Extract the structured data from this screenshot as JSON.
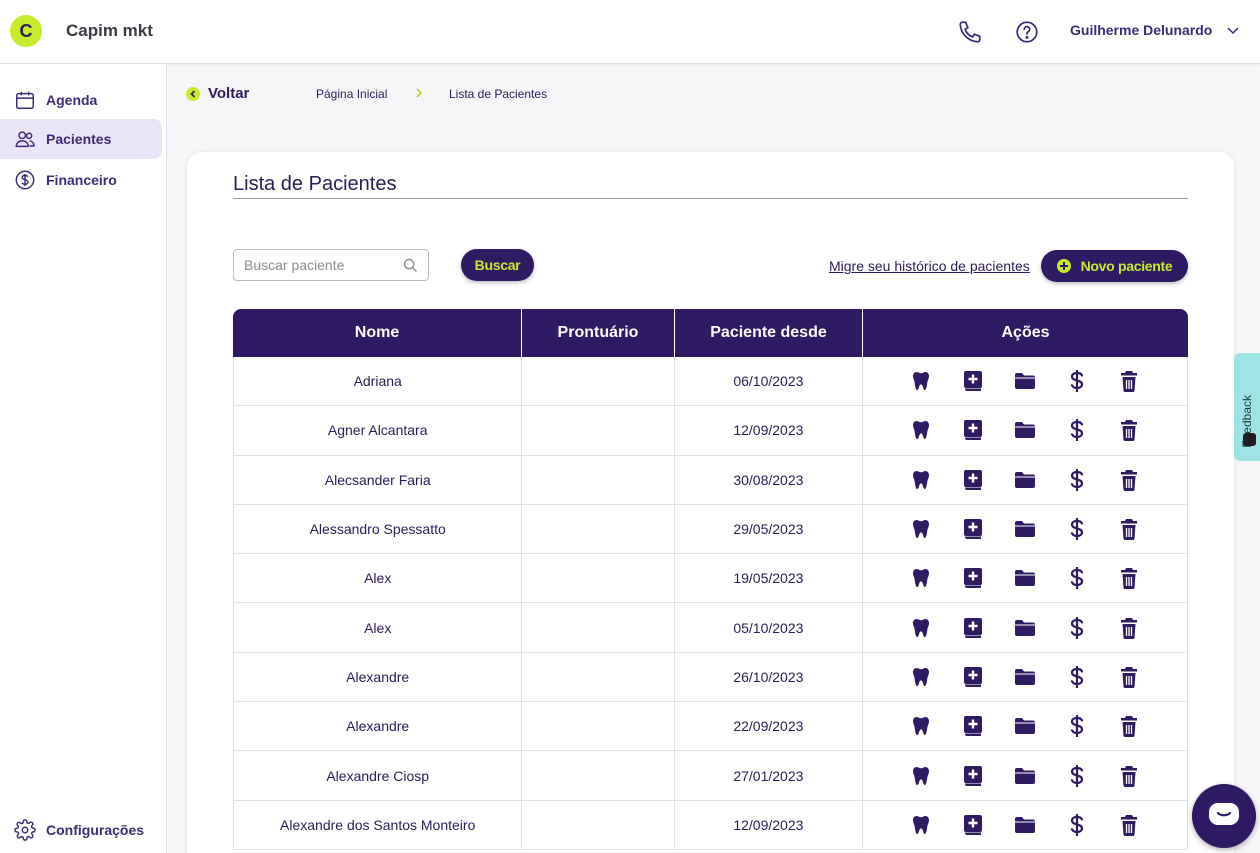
{
  "app": {
    "logo_letter": "C",
    "name": "Capim mkt"
  },
  "header": {
    "user_name": "Guilherme Delunardo"
  },
  "sidebar": {
    "items": [
      {
        "label": "Agenda",
        "icon": "calendar-icon"
      },
      {
        "label": "Pacientes",
        "icon": "users-icon",
        "active": true
      },
      {
        "label": "Financeiro",
        "icon": "dollar-circle-icon"
      }
    ],
    "settings_label": "Configurações"
  },
  "breadcrumb": {
    "back_label": "Voltar",
    "home": "Página Inicial",
    "current": "Lista de Pacientes"
  },
  "page": {
    "title": "Lista de Pacientes",
    "search_placeholder": "Buscar paciente",
    "search_value": "",
    "search_button": "Buscar",
    "migrate_link": "Migre seu histórico de pacientes",
    "new_patient_button": "Novo paciente"
  },
  "table": {
    "headers": [
      "Nome",
      "Prontuário",
      "Paciente desde",
      "Ações"
    ],
    "rows": [
      {
        "name": "Adriana",
        "record": "",
        "since": "06/10/2023"
      },
      {
        "name": "Agner Alcantara",
        "record": "",
        "since": "12/09/2023"
      },
      {
        "name": "Alecsander Faria",
        "record": "",
        "since": "30/08/2023"
      },
      {
        "name": "Alessandro Spessatto",
        "record": "",
        "since": "29/05/2023"
      },
      {
        "name": "Alex",
        "record": "",
        "since": "19/05/2023"
      },
      {
        "name": "Alex",
        "record": "",
        "since": "05/10/2023"
      },
      {
        "name": "Alexandre",
        "record": "",
        "since": "26/10/2023"
      },
      {
        "name": "Alexandre",
        "record": "",
        "since": "22/09/2023"
      },
      {
        "name": "Alexandre Ciosp",
        "record": "",
        "since": "27/01/2023"
      },
      {
        "name": "Alexandre dos Santos Monteiro",
        "record": "",
        "since": "12/09/2023"
      }
    ],
    "action_icons": [
      "tooth-icon",
      "medical-record-icon",
      "folder-icon",
      "dollar-icon",
      "trash-icon"
    ]
  },
  "feedback_label": "Feedback",
  "colors": {
    "primary": "#2f1b63",
    "accent": "#c6ea2c",
    "feedback": "#9ee4e4"
  }
}
